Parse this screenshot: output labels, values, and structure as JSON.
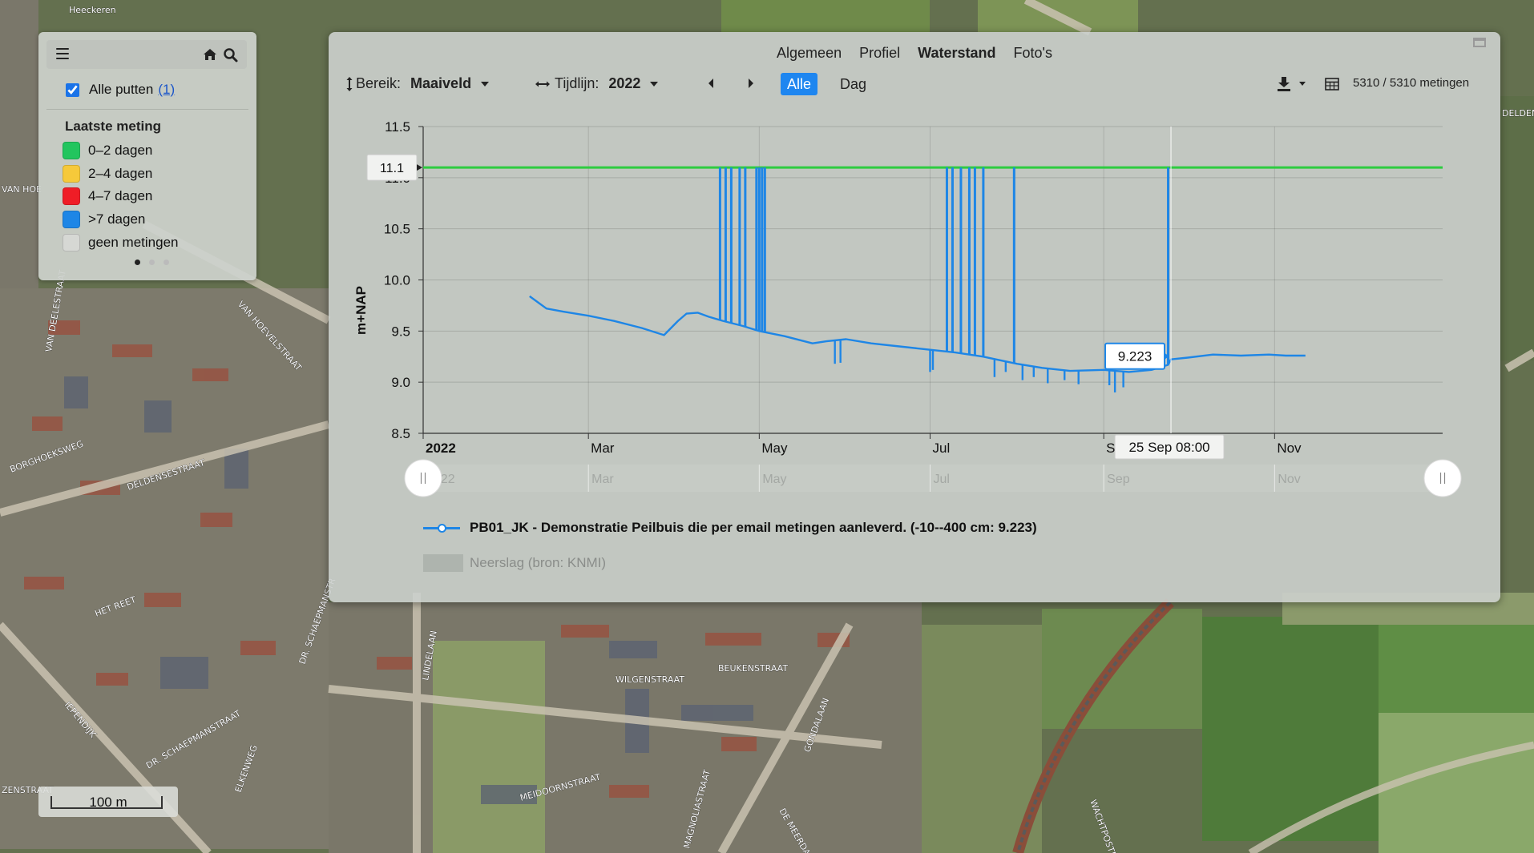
{
  "map": {
    "street_labels": [
      "Heeckeren",
      "VAN HOEVELSTRAAT",
      "VAN DEELESTRAAT",
      "BORGHOEKSWEG",
      "DELDENSESTRAAT",
      "HET REET",
      "DR. SCHAEPMANSTR",
      "IEPENDIJK",
      "DR. SCHAEPMANSTRAAT",
      "WILGENSTRAAT",
      "BEUKENSTRAAT",
      "LINDELAAN",
      "MEIDOORNSTRAAT",
      "MAGNOLIASTRAAT",
      "DE MEERDAM",
      "GONDALAAN",
      "ELKENWEG",
      "WACHTPOSTDIJK",
      "ZENSTRAAT",
      "DELDEN",
      "VAN HOE"
    ],
    "scale_label": "100 m"
  },
  "legend": {
    "all_wells_label": "Alle putten",
    "all_wells_count": "(1)",
    "all_wells_checked": true,
    "section_title": "Laatste meting",
    "items": [
      {
        "label": "0–2 dagen",
        "color": "#22c55e"
      },
      {
        "label": "2–4 dagen",
        "color": "#f6c93a"
      },
      {
        "label": "4–7 dagen",
        "color": "#ef1d26"
      },
      {
        "label": ">7 dagen",
        "color": "#1e86e6"
      },
      {
        "label": "geen metingen",
        "color": "#d6d8d4"
      }
    ],
    "page_dots": 3,
    "active_dot": 0
  },
  "window": {
    "tabs": [
      {
        "label": "Algemeen",
        "active": false
      },
      {
        "label": "Profiel",
        "active": false
      },
      {
        "label": "Waterstand",
        "active": true
      },
      {
        "label": "Foto's",
        "active": false
      }
    ],
    "range_label": "Bereik:",
    "range_value": "Maaiveld",
    "timeline_label": "Tijdlijn:",
    "timeline_value": "2022",
    "btn_all": "Alle",
    "btn_day": "Dag",
    "measurement_count": "5310 / 5310 metingen",
    "series_legend": "PB01_JK - Demonstratie Peilbuis die per email metingen aanleverd. (-10--400 cm: 9.223)",
    "rain_legend": "Neerslag (bron: KNMI)"
  },
  "chart_data": {
    "type": "line",
    "ylabel": "m+NAP",
    "ylim": [
      8.5,
      11.5
    ],
    "yticks": [
      8.5,
      9.0,
      9.5,
      10.0,
      10.5,
      11.0,
      11.5
    ],
    "xlim": [
      "2022-01-01",
      "2022-12-31"
    ],
    "xticks": [
      {
        "date": "2022-01-01",
        "label": "2022"
      },
      {
        "date": "2022-03-01",
        "label": "Mar"
      },
      {
        "date": "2022-05-01",
        "label": "May"
      },
      {
        "date": "2022-07-01",
        "label": "Jul"
      },
      {
        "date": "2022-09-01",
        "label": "Sep"
      },
      {
        "date": "2022-11-01",
        "label": "Nov"
      }
    ],
    "navigator_labels": [
      "2022",
      "Mar",
      "May",
      "Jul",
      "Sep",
      "Nov"
    ],
    "reference_line": {
      "value": 11.1,
      "label": "11.1",
      "color": "#2ecc40"
    },
    "tooltip": {
      "value": "9.223",
      "date_label": "25 Sep 08:00",
      "date": "2022-09-25"
    },
    "series": [
      {
        "name": "PB01_JK - Demonstratie Peilbuis die per email metingen aanleverd. (-10--400 cm: 9.223)",
        "color": "#1e86e6",
        "points": [
          [
            "2022-02-08",
            9.84
          ],
          [
            "2022-02-14",
            9.72
          ],
          [
            "2022-02-20",
            9.69
          ],
          [
            "2022-03-01",
            9.65
          ],
          [
            "2022-03-10",
            9.6
          ],
          [
            "2022-03-20",
            9.53
          ],
          [
            "2022-03-28",
            9.46
          ],
          [
            "2022-04-02",
            9.6
          ],
          [
            "2022-04-05",
            9.67
          ],
          [
            "2022-04-09",
            9.68
          ],
          [
            "2022-04-13",
            9.64
          ],
          [
            "2022-04-18",
            9.6
          ],
          [
            "2022-04-25",
            9.55
          ],
          [
            "2022-05-01",
            9.5
          ],
          [
            "2022-05-10",
            9.45
          ],
          [
            "2022-05-20",
            9.38
          ],
          [
            "2022-05-25",
            9.4
          ],
          [
            "2022-06-01",
            9.42
          ],
          [
            "2022-06-10",
            9.38
          ],
          [
            "2022-06-20",
            9.35
          ],
          [
            "2022-06-30",
            9.32
          ],
          [
            "2022-07-10",
            9.29
          ],
          [
            "2022-07-20",
            9.25
          ],
          [
            "2022-07-25",
            9.22
          ],
          [
            "2022-08-01",
            9.18
          ],
          [
            "2022-08-10",
            9.14
          ],
          [
            "2022-08-20",
            9.11
          ],
          [
            "2022-09-01",
            9.12
          ],
          [
            "2022-09-10",
            9.1
          ],
          [
            "2022-09-18",
            9.12
          ],
          [
            "2022-09-24",
            9.17
          ],
          [
            "2022-09-25",
            9.223
          ],
          [
            "2022-10-01",
            9.24
          ],
          [
            "2022-10-10",
            9.27
          ],
          [
            "2022-10-20",
            9.26
          ],
          [
            "2022-10-30",
            9.27
          ],
          [
            "2022-11-05",
            9.26
          ],
          [
            "2022-11-12",
            9.26
          ]
        ],
        "spikes": [
          {
            "date": "2022-04-17",
            "y": 11.1
          },
          {
            "date": "2022-04-19",
            "y": 11.1
          },
          {
            "date": "2022-04-21",
            "y": 11.1
          },
          {
            "date": "2022-04-24",
            "y": 11.1
          },
          {
            "date": "2022-04-26",
            "y": 11.1
          },
          {
            "date": "2022-04-30",
            "y": 11.1
          },
          {
            "date": "2022-05-01",
            "y": 11.1
          },
          {
            "date": "2022-05-02",
            "y": 11.1
          },
          {
            "date": "2022-05-03",
            "y": 11.1
          },
          {
            "date": "2022-07-07",
            "y": 11.1
          },
          {
            "date": "2022-07-09",
            "y": 11.1
          },
          {
            "date": "2022-07-12",
            "y": 11.1
          },
          {
            "date": "2022-07-15",
            "y": 11.1
          },
          {
            "date": "2022-07-17",
            "y": 11.1
          },
          {
            "date": "2022-07-20",
            "y": 11.1
          },
          {
            "date": "2022-07-31",
            "y": 11.1
          },
          {
            "date": "2022-09-24",
            "y": 11.1
          }
        ],
        "dips": [
          {
            "date": "2022-05-28",
            "y": 9.18
          },
          {
            "date": "2022-05-30",
            "y": 9.19
          },
          {
            "date": "2022-07-01",
            "y": 9.1
          },
          {
            "date": "2022-07-02",
            "y": 9.12
          },
          {
            "date": "2022-07-24",
            "y": 9.05
          },
          {
            "date": "2022-07-28",
            "y": 9.1
          },
          {
            "date": "2022-08-03",
            "y": 9.02
          },
          {
            "date": "2022-08-07",
            "y": 9.05
          },
          {
            "date": "2022-08-12",
            "y": 8.99
          },
          {
            "date": "2022-08-18",
            "y": 9.02
          },
          {
            "date": "2022-08-23",
            "y": 8.98
          },
          {
            "date": "2022-09-03",
            "y": 8.97
          },
          {
            "date": "2022-09-05",
            "y": 8.9
          },
          {
            "date": "2022-09-08",
            "y": 8.95
          }
        ]
      }
    ]
  }
}
